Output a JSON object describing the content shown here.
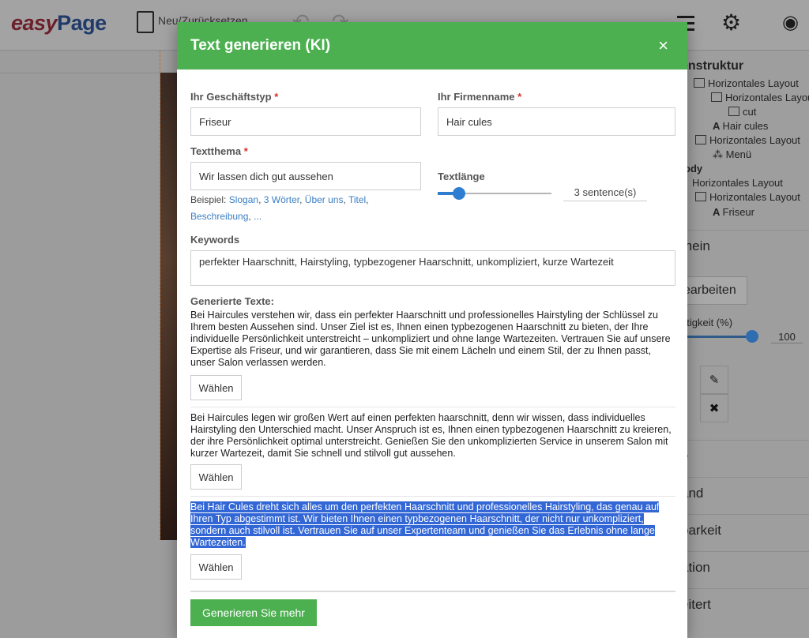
{
  "app": {
    "logo_easy": "easy",
    "logo_page": "Page",
    "toolbar_reset": "Neu/Zurücksetzen"
  },
  "right_panel": {
    "title": "enstruktur",
    "tree": [
      {
        "label": "Horizontales Layout"
      },
      {
        "label": "Horizontales Layout"
      },
      {
        "label": "cut"
      },
      {
        "label": "Hair cules"
      },
      {
        "label": "Horizontales Layout"
      },
      {
        "label": "Menü"
      },
      {
        "label": "ody"
      },
      {
        "label": "Horizontales Layout"
      },
      {
        "label": "Horizontales Layout"
      },
      {
        "label": "Friseur"
      }
    ],
    "section_general": "mein",
    "edit_button": "earbeiten",
    "opacity_label": "htigkeit (%)",
    "opacity_value": "100",
    "sections": [
      "e",
      "and",
      "barkeit",
      "ation",
      "eitert"
    ]
  },
  "modal": {
    "title": "Text generieren (KI)",
    "close_icon": "×",
    "business_type_label": "Ihr Geschäftstyp",
    "business_type_value": "Friseur",
    "company_name_label": "Ihr Firmenname",
    "company_name_value": "Hair cules",
    "topic_label": "Textthema",
    "topic_value": "Wir lassen dich gut aussehen",
    "example_prefix": "Beispiel:",
    "examples": [
      "Slogan",
      "3 Wörter",
      "Über uns",
      "Titel",
      "Beschreibung",
      "..."
    ],
    "text_length_label": "Textlänge",
    "text_length_value": 3,
    "text_length_max": 20,
    "text_length_display": "3   sentence(s)",
    "keywords_label": "Keywords",
    "keywords_value": "perfekter Haarschnitt, Hairstyling, typbezogener Haarschnitt, unkompliziert, kurze Wartezeit",
    "generated_title": "Generierte Texte:",
    "generated": [
      {
        "text": "Bei Haircules verstehen wir, dass ein perfekter Haarschnitt und professionelles Hairstyling der Schlüssel zu Ihrem besten Aussehen sind. Unser Ziel ist es, Ihnen einen typbezogenen Haarschnitt zu bieten, der Ihre individuelle Persönlichkeit unterstreicht – unkompliziert und ohne lange Wartezeiten. Vertrauen Sie auf unsere Expertise als Friseur, und wir garantieren, dass Sie mit einem Lächeln und einem Stil, der zu Ihnen passt, unser Salon verlassen werden.",
        "button": "Wählen"
      },
      {
        "text": "Bei Haircules legen wir großen Wert auf einen perfekten haarschnitt, denn wir wissen, dass individuelles Hairstyling den Unterschied macht. Unser Anspruch ist es, Ihnen einen typbezogenen Haarschnitt zu kreieren, der ihre Persönlichkeit optimal unterstreicht. Genießen Sie den unkomplizierten Service in unserem Salon mit kurzer Wartezeit, damit Sie schnell und stilvoll gut aussehen.",
        "button": "Wählen"
      },
      {
        "text": "Bei Hair Cules dreht sich alles um den perfekten Haarschnitt und professionelles Hairstyling, das genau auf Ihren Typ abgestimmt ist. Wir bieten Ihnen einen typbezogenen Haarschnitt, der nicht nur unkompliziert, sondern auch stilvoll ist. Vertrauen Sie auf unser Expertenteam und genießen Sie das Erlebnis ohne lange Wartezeiten.",
        "button": "Wählen"
      }
    ],
    "generate_more": "Generieren Sie mehr"
  },
  "colors": {
    "accent_green": "#4cb050",
    "link_blue": "#3a7fc4",
    "selection_blue": "#3367d6",
    "required_red": "#d9302c"
  }
}
